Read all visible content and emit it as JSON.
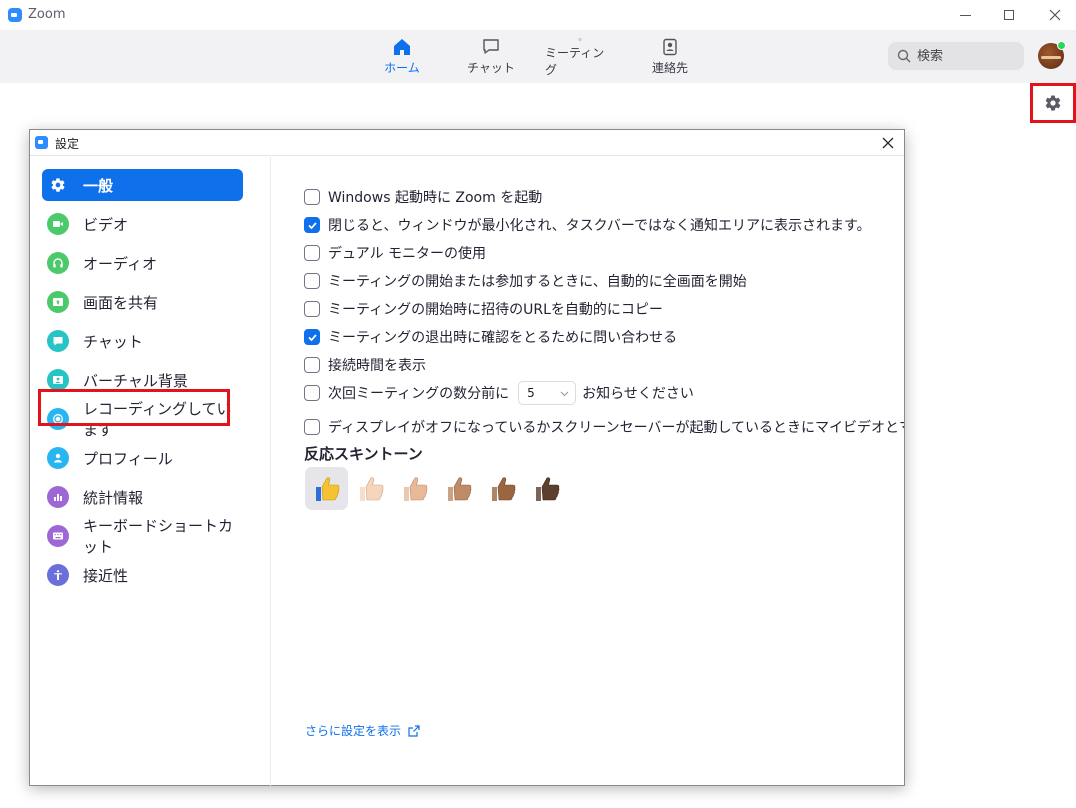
{
  "app": {
    "title": "Zoom"
  },
  "nav": {
    "tabs": [
      {
        "label": "ホーム",
        "icon": "home-icon",
        "active": true
      },
      {
        "label": "チャット",
        "icon": "chat-icon",
        "active": false
      },
      {
        "label": "ミーティング",
        "icon": "clock-icon",
        "active": false
      },
      {
        "label": "連絡先",
        "icon": "contacts-icon",
        "active": false
      }
    ],
    "search_placeholder": "検索"
  },
  "settings": {
    "title": "設定",
    "sidebar": [
      {
        "label": "一般",
        "icon": "gear-icon",
        "color": "#0e71eb"
      },
      {
        "label": "ビデオ",
        "icon": "video-camera-icon",
        "color": "#4cc96a"
      },
      {
        "label": "オーディオ",
        "icon": "headphones-icon",
        "color": "#4cc96a"
      },
      {
        "label": "画面を共有",
        "icon": "share-screen-icon",
        "color": "#4cc96a"
      },
      {
        "label": "チャット",
        "icon": "chat-icon",
        "color": "#26c4c4"
      },
      {
        "label": "バーチャル背景",
        "icon": "virtual-background-icon",
        "color": "#26c4c4"
      },
      {
        "label": "レコーディングしています",
        "icon": "record-icon",
        "color": "#27b6f2"
      },
      {
        "label": "プロフィール",
        "icon": "profile-icon",
        "color": "#27b6f2"
      },
      {
        "label": "統計情報",
        "icon": "statistics-icon",
        "color": "#9e67d6"
      },
      {
        "label": "キーボードショートカット",
        "icon": "keyboard-icon",
        "color": "#9e67d6"
      },
      {
        "label": "接近性",
        "icon": "accessibility-icon",
        "color": "#6b6fd9"
      }
    ],
    "options": [
      {
        "label": "Windows 起動時に Zoom を起動",
        "checked": false
      },
      {
        "label": "閉じると、ウィンドウが最小化され、タスクバーではなく通知エリアに表示されます。",
        "checked": true
      },
      {
        "label": "デュアル モニターの使用",
        "checked": false
      },
      {
        "label": "ミーティングの開始または参加するときに、自動的に全画面を開始",
        "checked": false
      },
      {
        "label": "ミーティングの開始時に招待のURLを自動的にコピー",
        "checked": false
      },
      {
        "label": "ミーティングの退出時に確認をとるために問い合わせる",
        "checked": true
      },
      {
        "label": "接続時間を表示",
        "checked": false
      }
    ],
    "reminder": {
      "prefix": "次回ミーティングの数分前に",
      "value": "5",
      "suffix": "お知らせください",
      "checked": false
    },
    "screensaver_option": {
      "label": "ディスプレイがオフになっているかスクリーンセーバーが起動しているときにマイビデオとマイオーディオ",
      "checked": false
    },
    "skin_tone_title": "反応スキントーン",
    "skin_tones": [
      "#f5c234",
      "#f5d6bc",
      "#e8b999",
      "#bf8b67",
      "#9a6640",
      "#5c3f2c"
    ],
    "more_settings_link": "さらに設定を表示"
  },
  "colors": {
    "accent": "#0e71eb",
    "highlight": "#e1141e"
  }
}
